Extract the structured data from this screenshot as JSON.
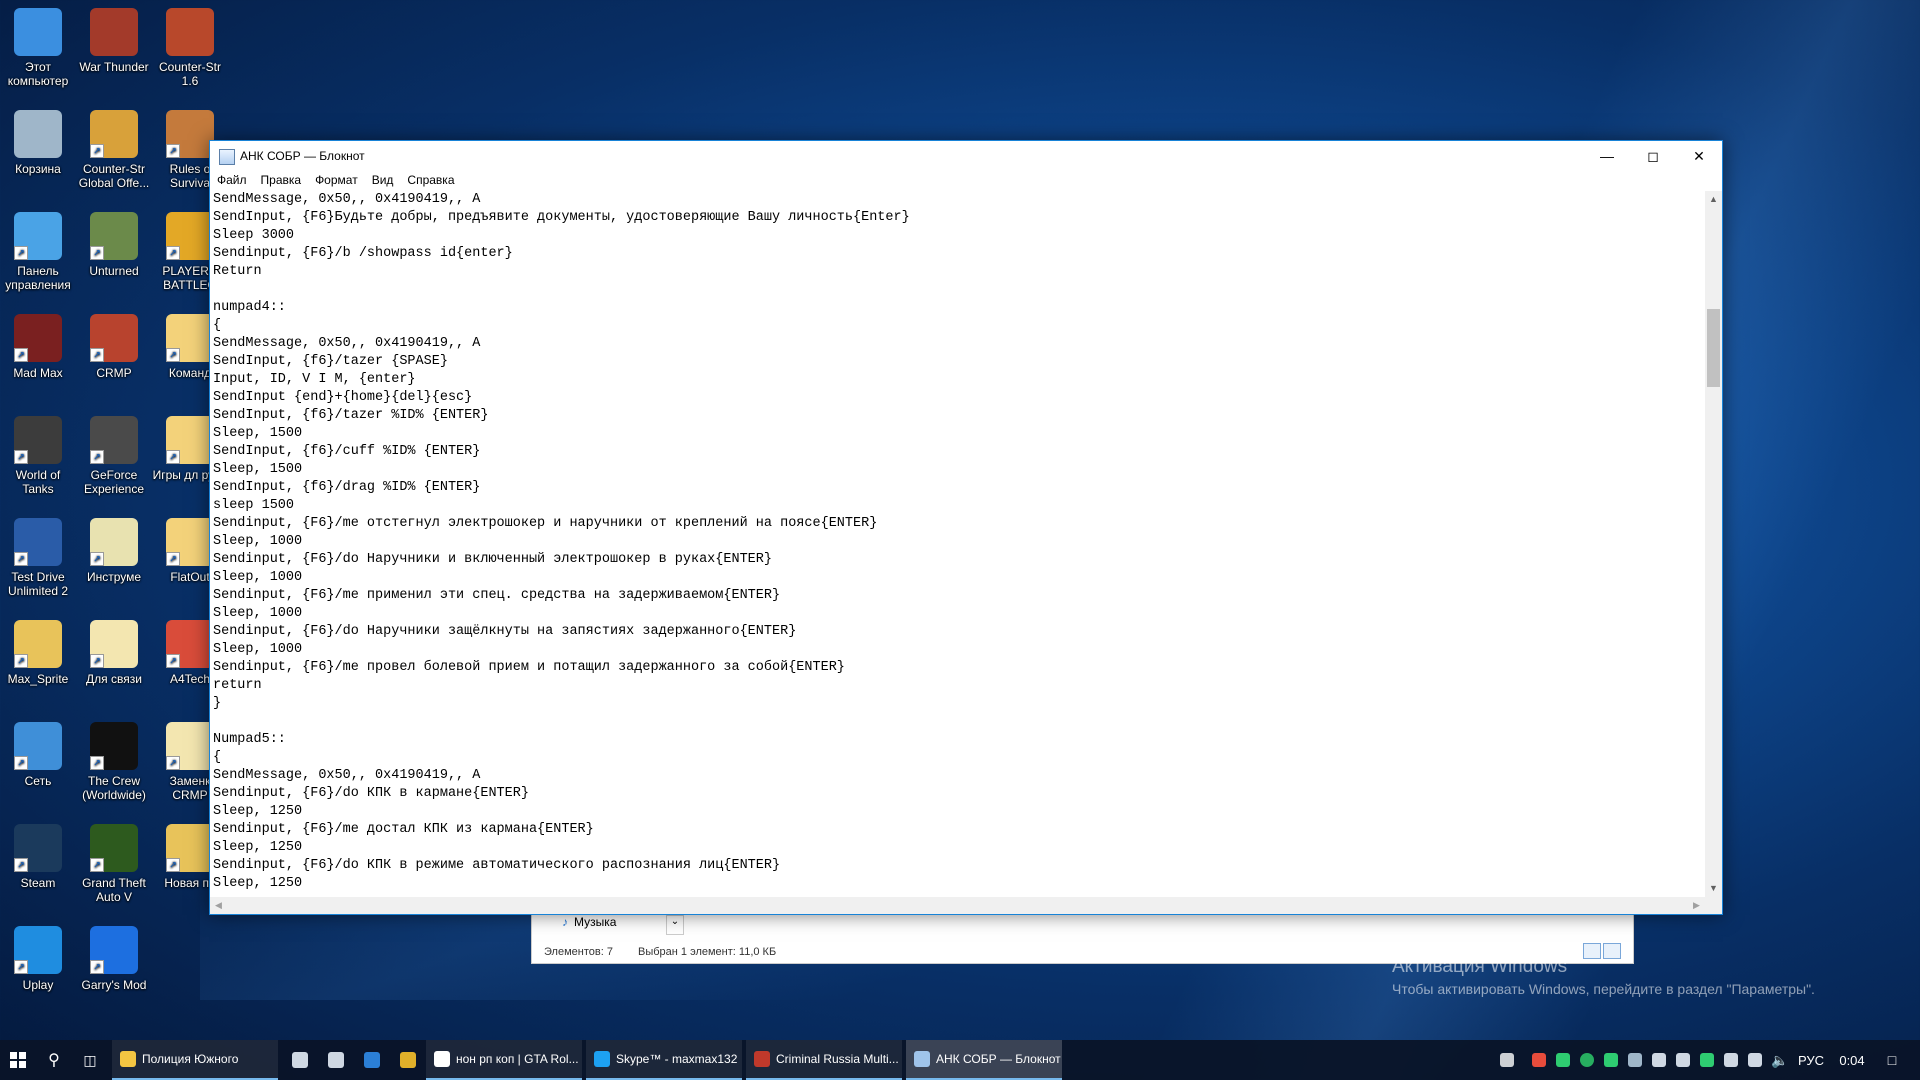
{
  "desktop": {
    "icons": [
      {
        "label": "Этот компьютер",
        "color": "#3b8fe0",
        "glyph": "monitor-icon"
      },
      {
        "label": "War Thunder",
        "color": "#a33a2a",
        "glyph": "war-thunder-icon"
      },
      {
        "label": "Counter-Str 1.6",
        "color": "#b8482b",
        "glyph": "counter-strike-icon"
      },
      {
        "label": "Корзина",
        "color": "#9fb6c9",
        "glyph": "recycle-bin-icon"
      },
      {
        "label": "Counter-Str Global Offe...",
        "color": "#d8a13a",
        "glyph": "csgo-icon"
      },
      {
        "label": "Rules o Surviva",
        "color": "#c47a3c",
        "glyph": "rules-of-survival-icon"
      },
      {
        "label": "Панель управления",
        "color": "#4aa3e6",
        "glyph": "control-panel-icon"
      },
      {
        "label": "Unturned",
        "color": "#6b8a4a",
        "glyph": "unturned-icon"
      },
      {
        "label": "PLAYERU BATTLEG",
        "color": "#e3a826",
        "glyph": "pubg-icon"
      },
      {
        "label": "Mad Max",
        "color": "#7a2020",
        "glyph": "mad-max-icon"
      },
      {
        "label": "CRMP",
        "color": "#b8432e",
        "glyph": "crmp-icon"
      },
      {
        "label": "Команд",
        "color": "#f3d27a",
        "glyph": "folder-icon"
      },
      {
        "label": "World of Tanks",
        "color": "#3c3c3c",
        "glyph": "world-of-tanks-icon"
      },
      {
        "label": "GeForce Experience",
        "color": "#4a4a4a",
        "glyph": "geforce-icon"
      },
      {
        "label": "Игры дл руля",
        "color": "#f3d27a",
        "glyph": "folder-icon"
      },
      {
        "label": "Test Drive Unlimited 2",
        "color": "#2a5ca8",
        "glyph": "test-drive-icon"
      },
      {
        "label": "Инструме",
        "color": "#e8e2b0",
        "glyph": "tools-icon"
      },
      {
        "label": "FlatOut",
        "color": "#f3d27a",
        "glyph": "folder-icon"
      },
      {
        "label": "Max_Sprite",
        "color": "#e8c35a",
        "glyph": "user-folder-icon"
      },
      {
        "label": "Для связи",
        "color": "#f3e6b0",
        "glyph": "skype-file-icon"
      },
      {
        "label": "A4Tech",
        "color": "#d94c3a",
        "glyph": "a4tech-icon"
      },
      {
        "label": "Сеть",
        "color": "#3f8fd8",
        "glyph": "network-icon"
      },
      {
        "label": "The Crew (Worldwide)",
        "color": "#111111",
        "glyph": "the-crew-icon"
      },
      {
        "label": "Заменк CRMP",
        "color": "#f3e6b0",
        "glyph": "folder-icon"
      },
      {
        "label": "Steam",
        "color": "#1b3a5c",
        "glyph": "steam-icon"
      },
      {
        "label": "Grand Theft Auto V",
        "color": "#2d5a1e",
        "glyph": "gta-v-icon"
      },
      {
        "label": "Новая па",
        "color": "#e8c35a",
        "glyph": "folder-icon"
      },
      {
        "label": "Uplay",
        "color": "#1f8de0",
        "glyph": "uplay-icon"
      },
      {
        "label": "Garry's Mod",
        "color": "#1d6fe0",
        "glyph": "garrys-mod-icon"
      }
    ]
  },
  "explorer": {
    "folder": "Музыка",
    "items_count": "Элементов: 7",
    "selected": "Выбран 1 элемент: 11,0 КБ"
  },
  "notepad": {
    "title": "АНК СОБР — Блокнот",
    "menu": [
      "Файл",
      "Правка",
      "Формат",
      "Вид",
      "Справка"
    ],
    "lines": [
      "SendMessage, 0x50,, 0x4190419,, A",
      "SendInput, {F6}Будьте добры, предъявите документы, удостоверяющие Вашу личность{Enter}",
      "Sleep 3000",
      "Sendinput, {F6}/b /showpass id{enter}",
      "Return",
      "",
      "numpad4::",
      "{",
      "SendMessage, 0x50,, 0x4190419,, A",
      "SendInput, {f6}/tazer {SPASE}",
      "Input, ID, V I M, {enter}",
      "SendInput {end}+{home}{del}{esc}",
      "SendInput, {f6}/tazer %ID% {ENTER}",
      "Sleep, 1500",
      "SendInput, {f6}/cuff %ID% {ENTER}",
      "Sleep, 1500",
      "SendInput, {f6}/drag %ID% {ENTER}",
      "sleep 1500",
      "Sendinput, {F6}/me отстегнул электрошокер и наручники от креплений на поясе{ENTER}",
      "Sleep, 1000",
      "Sendinput, {F6}/do Наручники и включенный электрошокер в руках{ENTER}",
      "Sleep, 1000",
      "Sendinput, {F6}/me применил эти спец. средства на задерживаемом{ENTER}",
      "Sleep, 1000",
      "Sendinput, {F6}/do Наручники защёлкнуты на запястиях задержанного{ENTER}",
      "Sleep, 1000",
      "Sendinput, {F6}/me провел болевой прием и потащил задержанного за собой{ENTER}",
      "return",
      "}",
      "",
      "Numpad5::",
      "{",
      "SendMessage, 0x50,, 0x4190419,, A",
      "Sendinput, {F6}/do КПК в кармане{ENTER}",
      "Sleep, 1250",
      "Sendinput, {F6}/me достал КПК из кармана{ENTER}",
      "Sleep, 1250",
      "Sendinput, {F6}/do КПК в режиме автоматического распознания лиц{ENTER}",
      "Sleep, 1250"
    ]
  },
  "watermark": {
    "line1": "Активация Windows",
    "line2": "Чтобы активировать Windows, перейдите в раздел \"Параметры\"."
  },
  "taskbar": {
    "apps": [
      {
        "label": "Полиция Южного",
        "color": "#f3c542",
        "state": "open"
      },
      {
        "label": "",
        "color": "#cfd8e3",
        "state": "pinned",
        "glyph": "mail-icon"
      },
      {
        "label": "",
        "color": "#cfd8e3",
        "state": "pinned",
        "glyph": "store-icon"
      },
      {
        "label": "",
        "color": "#2b7fd6",
        "state": "pinned",
        "glyph": "edge-icon"
      },
      {
        "label": "",
        "color": "#e0b02a",
        "state": "pinned",
        "glyph": "chrome-icon"
      },
      {
        "label": "нон рп коп | GTA Rol...",
        "color": "#ffffff",
        "state": "open"
      },
      {
        "label": "Skype™ - maxmax132",
        "color": "#1da1f2",
        "state": "open"
      },
      {
        "label": "Criminal Russia Multi...",
        "color": "#c0392b",
        "state": "open"
      },
      {
        "label": "АНК СОБР — Блокнот",
        "color": "#9fc4ea",
        "state": "active"
      }
    ],
    "language": "РУС",
    "time": "0:04"
  }
}
